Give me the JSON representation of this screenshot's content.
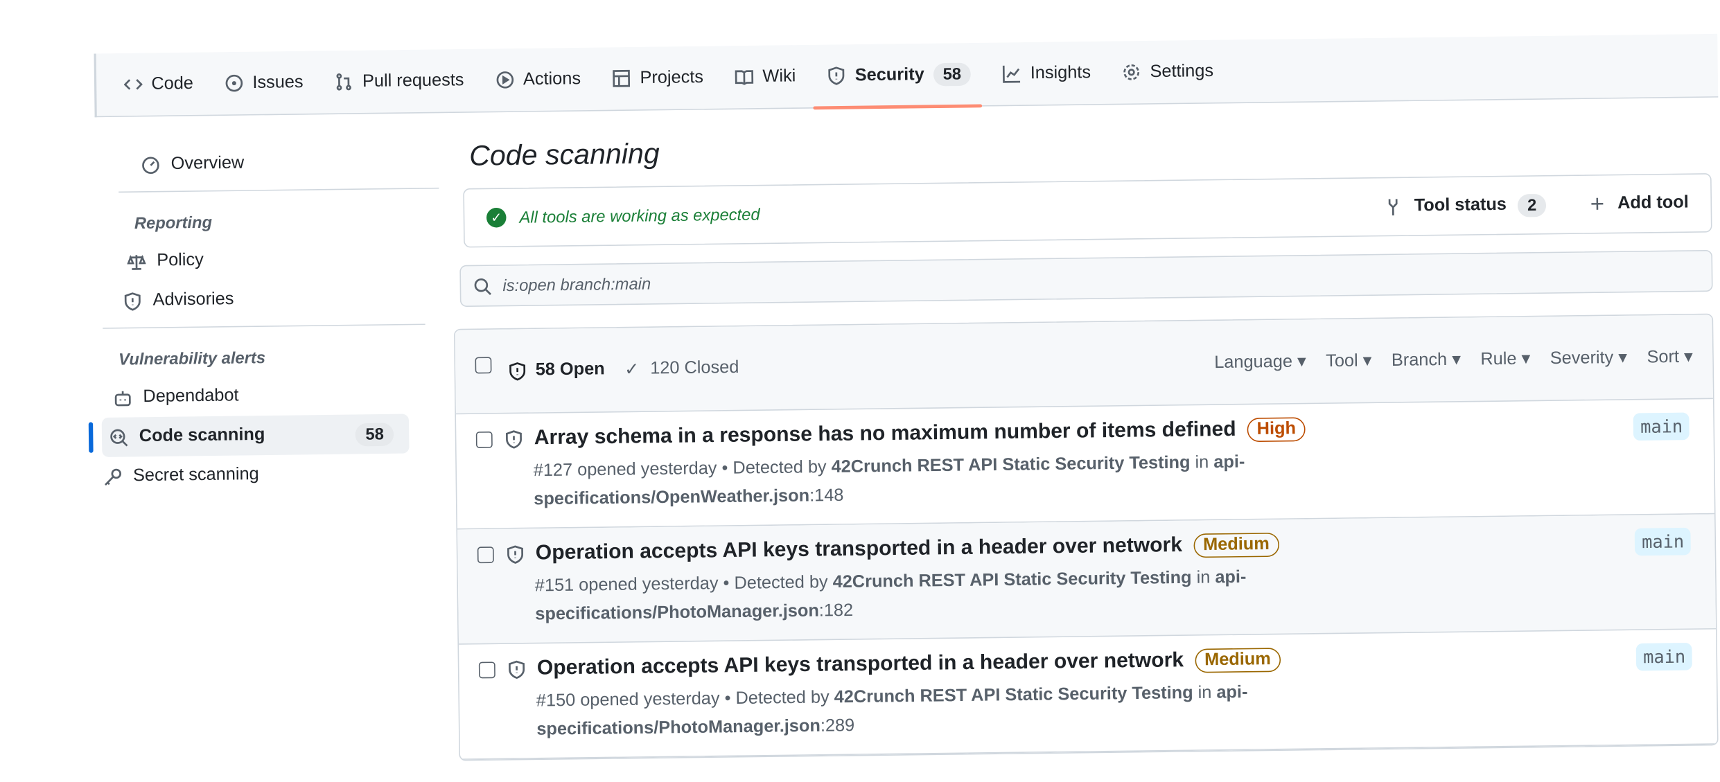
{
  "nav": {
    "tabs": [
      {
        "label": "Code",
        "icon": "code-icon"
      },
      {
        "label": "Issues",
        "icon": "issue-icon"
      },
      {
        "label": "Pull requests",
        "icon": "pull-request-icon"
      },
      {
        "label": "Actions",
        "icon": "play-icon"
      },
      {
        "label": "Projects",
        "icon": "table-icon"
      },
      {
        "label": "Wiki",
        "icon": "book-icon"
      },
      {
        "label": "Security",
        "icon": "shield-icon",
        "count": "58",
        "active": true
      },
      {
        "label": "Insights",
        "icon": "graph-icon"
      },
      {
        "label": "Settings",
        "icon": "gear-icon"
      }
    ]
  },
  "sidebar": {
    "overview": "Overview",
    "reporting_heading": "Reporting",
    "policy": "Policy",
    "advisories": "Advisories",
    "vuln_heading": "Vulnerability alerts",
    "dependabot": "Dependabot",
    "code_scanning": "Code scanning",
    "code_scanning_count": "58",
    "secret_scanning": "Secret scanning"
  },
  "main": {
    "title": "Code scanning",
    "status_text": "All tools are working as expected",
    "tool_status_label": "Tool status",
    "tool_status_count": "2",
    "add_tool_label": "Add tool",
    "search_value": "is:open branch:main",
    "open_label": "58 Open",
    "closed_label": "120 Closed",
    "filters": [
      "Language",
      "Tool",
      "Branch",
      "Rule",
      "Severity",
      "Sort"
    ],
    "alerts": [
      {
        "title": "Array schema in a response has no maximum number of items defined",
        "severity": "High",
        "meta_prefix": "#127 opened yesterday • Detected by ",
        "tool": "42Crunch REST API Static Security Testing",
        "in": " in ",
        "file": "api-specifications/OpenWeather.json",
        "line": ":148",
        "branch": "main"
      },
      {
        "title": "Operation accepts API keys transported in a header over network",
        "severity": "Medium",
        "meta_prefix": "#151 opened yesterday • Detected by ",
        "tool": "42Crunch REST API Static Security Testing",
        "in": " in ",
        "file": "api-specifications/PhotoManager.json",
        "line": ":182",
        "branch": "main"
      },
      {
        "title": "Operation accepts API keys transported in a header over network",
        "severity": "Medium",
        "meta_prefix": "#150 opened yesterday • Detected by ",
        "tool": "42Crunch REST API Static Security Testing",
        "in": " in ",
        "file": "api-specifications/PhotoManager.json",
        "line": ":289",
        "branch": "main"
      }
    ]
  },
  "colors": {
    "accent": "#0969da",
    "tab_underline": "#fd8c73",
    "success": "#1a7f37",
    "high": "#bc4c00",
    "medium": "#9a6700",
    "branch_bg": "#ddf4ff"
  }
}
